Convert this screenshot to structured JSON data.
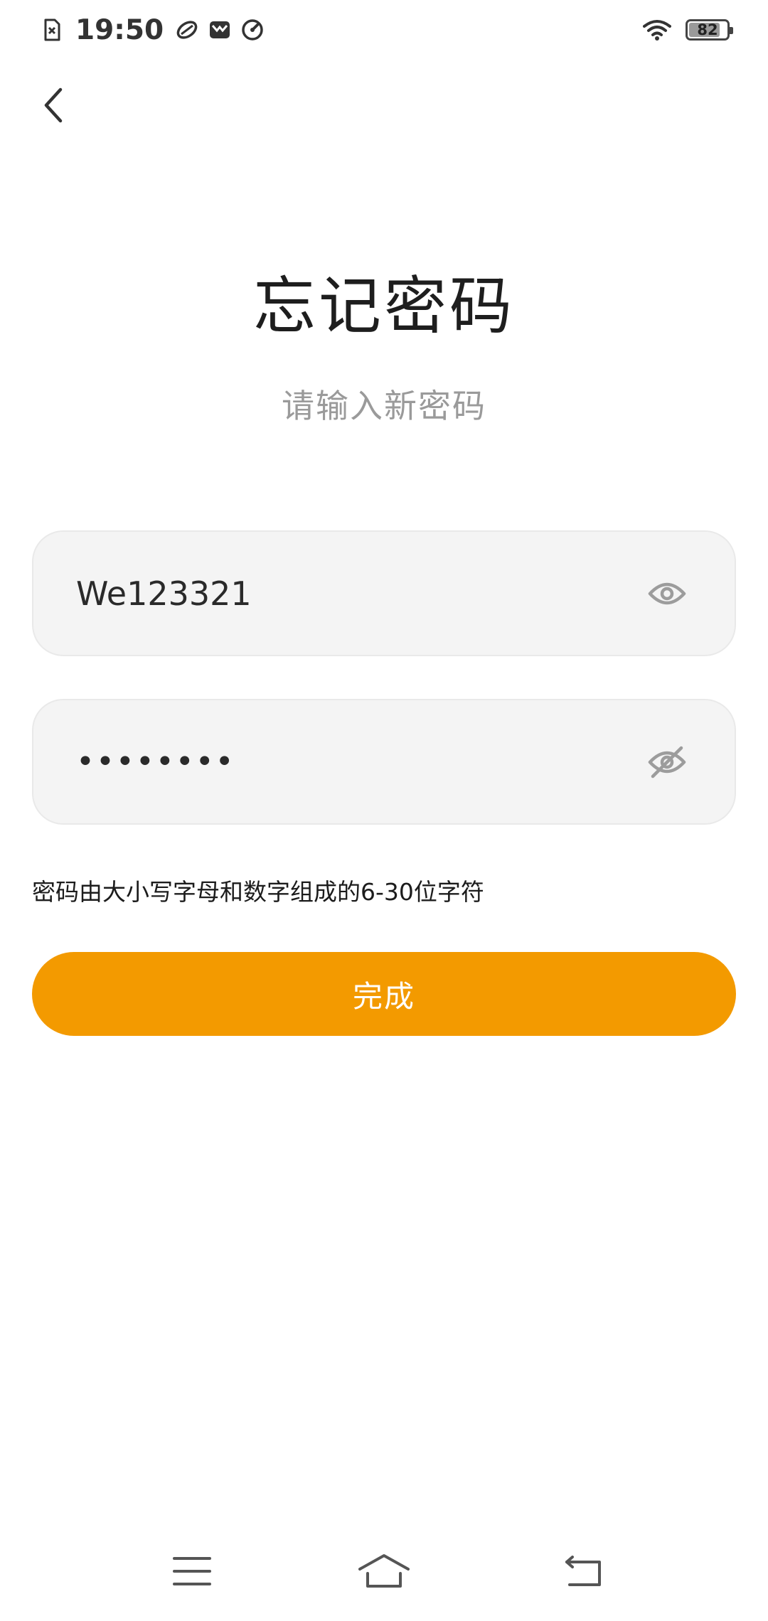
{
  "status_bar": {
    "time": "19:50",
    "battery_level": "82",
    "battery_fraction": 0.82,
    "left_icons": [
      "sim-card-icon",
      "app-leaf-icon",
      "mail-app-icon",
      "speed-app-icon"
    ],
    "right_icons": [
      "wifi-icon",
      "battery-icon"
    ]
  },
  "header": {
    "back_icon": "chevron-left-icon"
  },
  "main": {
    "title": "忘记密码",
    "subtitle": "请输入新密码",
    "new_password": {
      "value": "We123321",
      "toggle_icon": "eye-open-icon"
    },
    "confirm_password": {
      "value": "••••••••",
      "toggle_icon": "eye-off-icon"
    },
    "hint": "密码由大小写字母和数字组成的6-30位字符",
    "submit_label": "完成"
  },
  "nav_bar": {
    "icons": [
      "menu-icon",
      "home-icon",
      "back-icon"
    ]
  },
  "colors": {
    "accent": "#f39a00",
    "field_bg": "#f4f4f4",
    "subtitle": "#9a9a9a",
    "icon_gray": "#9c9c9c"
  }
}
